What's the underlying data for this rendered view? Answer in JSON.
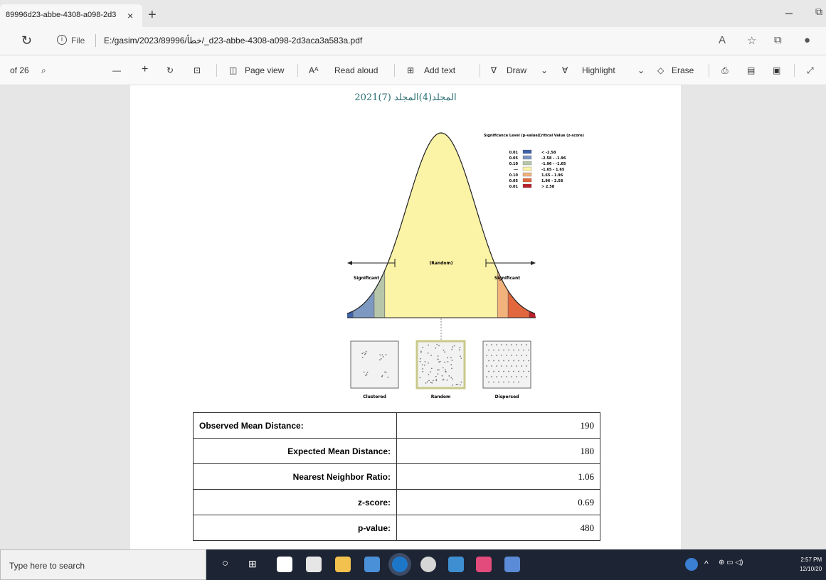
{
  "tab": {
    "title": "89996d23-abbe-4308-a098-2d3",
    "close": "×",
    "new_tab": "+"
  },
  "window": {
    "minimize": "–",
    "restore": "⧉"
  },
  "address": {
    "file_label": "File",
    "url": "E:/gasim/2023/89996/خطأ/_d23-abbe-4308-a098-2d3aca3a583a.pdf"
  },
  "toolbar": {
    "page_of": "of 26",
    "zoom_out": "—",
    "zoom_in": "+",
    "page_view": "Page view",
    "read_aloud": "Read aloud",
    "add_text": "Add text",
    "draw": "Draw",
    "highlight": "Highlight",
    "erase": "Erase"
  },
  "page": {
    "header": "المجلد(4)المجلد (7)2021",
    "figure": {
      "legend_title_left": "Significance Level (p-value)",
      "legend_title_right": "Critical Value (z-score)",
      "legend": [
        {
          "p": "0.01",
          "z": "< -2.58",
          "color": "#3f63a8"
        },
        {
          "p": "0.05",
          "z": "-2.58 - -1.96",
          "color": "#7d99c2"
        },
        {
          "p": "0.10",
          "z": "-1.96 - -1.65",
          "color": "#b7c6a9"
        },
        {
          "p": "---",
          "z": "-1.65 - 1.65",
          "color": "#fbf3a6"
        },
        {
          "p": "0.10",
          "z": "1.65 - 1.96",
          "color": "#f2b27c"
        },
        {
          "p": "0.05",
          "z": "1.96 - 2.58",
          "color": "#e2673d"
        },
        {
          "p": "0.01",
          "z": "> 2.58",
          "color": "#b8202a"
        }
      ],
      "label_significant_left": "Significant",
      "label_random": "(Random)",
      "label_significant_right": "Significant",
      "patterns": [
        "Clustered",
        "Random",
        "Dispersed"
      ]
    },
    "table": [
      {
        "label": "Observed Mean Distance:",
        "value": "190",
        "align": "left"
      },
      {
        "label": "Expected Mean Distance:",
        "value": "180",
        "align": "right"
      },
      {
        "label": "Nearest Neighbor Ratio:",
        "value": "1.06",
        "align": "right"
      },
      {
        "label": "z-score:",
        "value": "0.69",
        "align": "right"
      },
      {
        "label": "p-value:",
        "value": "480",
        "align": "right"
      }
    ]
  },
  "taskbar": {
    "search_placeholder": "Type here to search",
    "time": "2:57 PM",
    "date": "12/10/20"
  }
}
